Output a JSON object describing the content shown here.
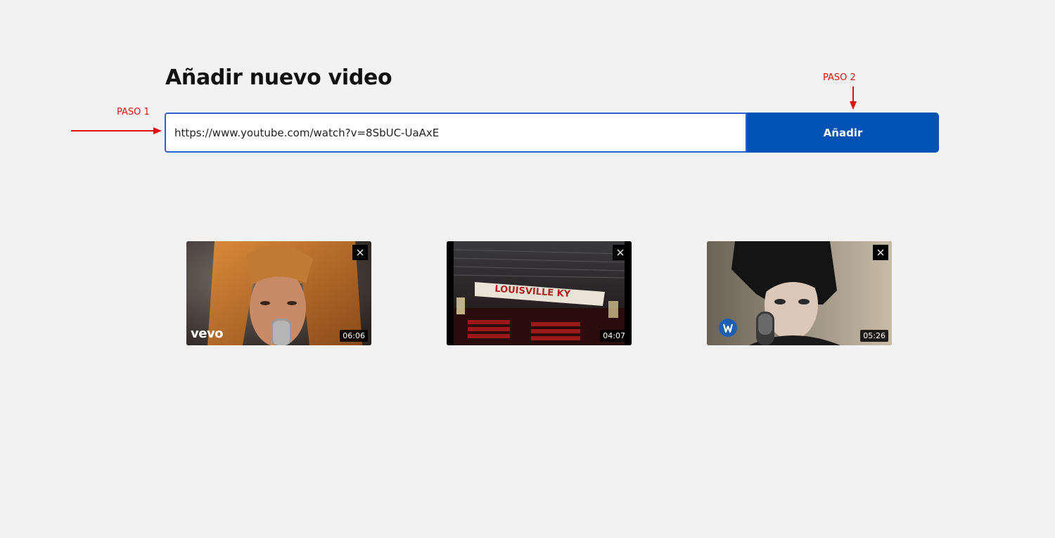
{
  "header": {
    "title": "Añadir nuevo video"
  },
  "annotations": {
    "step1": "PASO 1",
    "step2": "PASO 2",
    "color": "#e01010"
  },
  "form": {
    "url_value": "https://www.youtube.com/watch?v=8SbUC-UaAxE",
    "submit_label": "Añadir",
    "accent_color": "#0052b4"
  },
  "videos": [
    {
      "duration": "06:06",
      "badge": "vevo",
      "remove_icon": "close-icon"
    },
    {
      "duration": "04:07",
      "sign_text": "LOUISVILLE KY",
      "remove_icon": "close-icon"
    },
    {
      "duration": "05:26",
      "badge_icon": "warner-logo-icon",
      "remove_icon": "close-icon"
    }
  ]
}
